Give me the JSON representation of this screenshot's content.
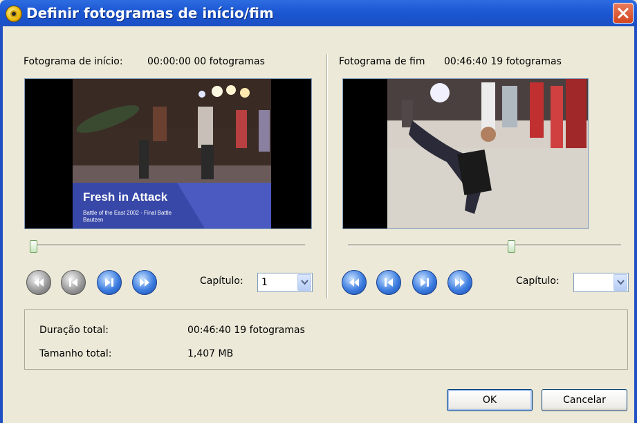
{
  "window": {
    "title": "Definir fotogramas de início/fim"
  },
  "start": {
    "label": "Fotograma de início:",
    "timecode": "00:00:00 00 fotogramas",
    "video_overlay": {
      "title": "Fresh in Attack",
      "subtitle_line1": "Battle of the East 2002 - Final Battle",
      "subtitle_line2": "Bautzen"
    },
    "slider_fraction": 0.0,
    "chapter_label": "Capítulo:",
    "chapter_value": "1"
  },
  "end": {
    "label": "Fotograma de fim",
    "timecode": "00:46:40 19 fotogramas",
    "slider_fraction": 0.6,
    "chapter_label": "Capítulo:",
    "chapter_value": ""
  },
  "summary": {
    "duration_label": "Duração total:",
    "duration_value": "00:46:40 19 fotogramas",
    "size_label": "Tamanho total:",
    "size_value": "1,407 MB"
  },
  "buttons": {
    "ok": "OK",
    "cancel": "Cancelar"
  },
  "icons": {
    "title": "dvd-app-icon",
    "close": "close-icon",
    "first": "skip-back-icon",
    "prev": "step-back-icon",
    "next": "step-forward-icon",
    "last": "skip-forward-icon"
  }
}
